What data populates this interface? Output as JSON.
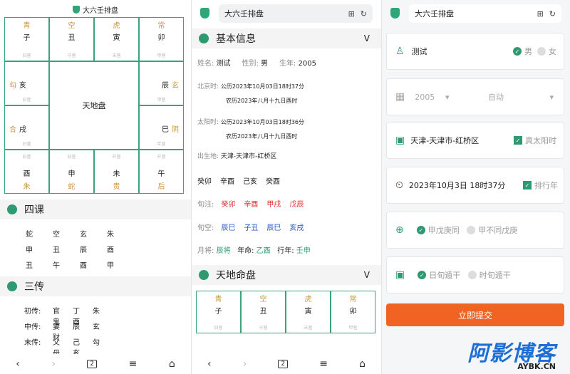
{
  "app_title": "大六壬排盘",
  "panel1": {
    "pan": {
      "top": [
        {
          "t": "青",
          "m": "子",
          "s": "旧营"
        },
        {
          "t": "空",
          "m": "丑",
          "s": "守营"
        },
        {
          "t": "虎",
          "m": "寅",
          "s": "未营"
        },
        {
          "t": "常",
          "m": "卯",
          "s": "甲营"
        }
      ],
      "left": [
        {
          "t": "勾",
          "m": "亥",
          "s": "旧营"
        },
        {
          "t": "合",
          "m": "戌",
          "s": "旧营"
        }
      ],
      "right": [
        {
          "t": "玄",
          "m": "辰",
          "s": "甲营"
        },
        {
          "t": "阴",
          "m": "巳",
          "s": "年营"
        }
      ],
      "bottom": [
        {
          "t": "朱",
          "m": "酉",
          "s": "旧营"
        },
        {
          "t": "蛇",
          "m": "申",
          "s": "旧营"
        },
        {
          "t": "贵",
          "m": "未",
          "s": "开营"
        },
        {
          "t": "后",
          "m": "午",
          "s": "开营"
        }
      ],
      "center": "天地盘"
    },
    "sike_title": "四课",
    "sike": [
      [
        "蛇",
        "空",
        "玄",
        "朱"
      ],
      [
        "申",
        "丑",
        "辰",
        "酉"
      ],
      [
        "丑",
        "午",
        "酉",
        "甲"
      ]
    ],
    "sanchuan_title": "三传",
    "sanchuan": [
      [
        "初传:",
        "官鬼",
        "丁酉",
        "朱"
      ],
      [
        "中传:",
        "妻财",
        "辰",
        "玄"
      ],
      [
        "末传:",
        "父母",
        "己亥",
        "勾"
      ]
    ]
  },
  "panel2": {
    "basic_title": "基本信息",
    "chevron": "V",
    "name_label": "姓名:",
    "name": "测试",
    "gender_label": "性别:",
    "gender": "男",
    "year_label": "生年:",
    "year": "2005",
    "beijing_label": "北京时:",
    "beijing_1": "公历2023年10月03日18时37分",
    "beijing_2": "农历2023年八月十九日酉时",
    "solar_label": "太阳时:",
    "solar_1": "公历2023年10月03日18时36分",
    "solar_2": "农历2023年八月十九日酉时",
    "place_label": "出生地:",
    "place": "天津-天津市-红桥区",
    "bazi": [
      "癸卯",
      "辛酉",
      "己亥",
      "癸酉"
    ],
    "xunzhu_label": "旬注:",
    "xunzhu": [
      "癸卯",
      "辛酉",
      "甲戌",
      "戊辰"
    ],
    "xunkong_label": "旬空:",
    "xunkong": [
      "辰巳",
      "子丑",
      "辰巳",
      "亥戌"
    ],
    "yuejiang_label": "月将:",
    "yuejiang": "辰将",
    "nianming_label": "年命:",
    "nianming": "乙酉",
    "xingnian_label": "行年:",
    "xingnian": "壬申",
    "tdm_title": "天地命盘",
    "tdm_top": [
      {
        "t": "青",
        "m": "子",
        "s": "旧营"
      },
      {
        "t": "空",
        "m": "丑",
        "s": "守营"
      },
      {
        "t": "虎",
        "m": "寅",
        "s": "未营"
      },
      {
        "t": "常",
        "m": "卯",
        "s": "甲营"
      }
    ]
  },
  "panel3": {
    "name": "测试",
    "male": "男",
    "female": "女",
    "year": "2005",
    "auto": "自动",
    "place": "天津-天津市-红桥区",
    "true_solar": "真太阳时",
    "datetime": "2023年10月3日 18时37分",
    "order_year": "排行年",
    "opt_a": "甲戊庚同",
    "opt_b": "甲不同戊庚",
    "opt_c": "日旬遁干",
    "opt_d": "时旬遁干",
    "submit": "立即提交"
  },
  "watermark": {
    "big": "阿影博客",
    "small": "AYBK.CN"
  },
  "nav": {
    "tab_count": "2"
  }
}
